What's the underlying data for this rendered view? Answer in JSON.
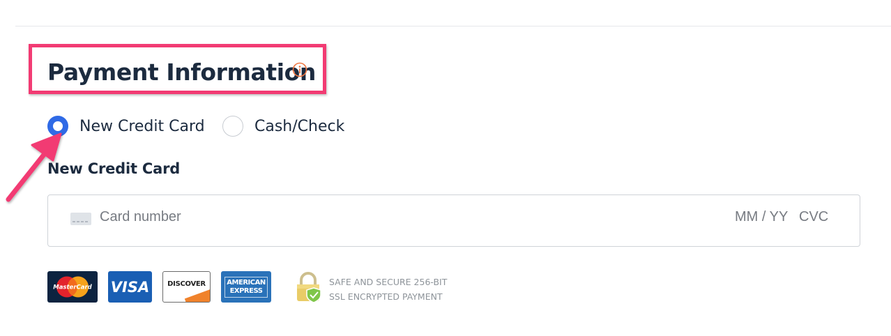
{
  "payment": {
    "title": "Payment Information",
    "options": [
      {
        "label": "New Credit Card",
        "selected": true
      },
      {
        "label": "Cash/Check",
        "selected": false
      }
    ],
    "subheading": "New Credit Card",
    "card_field": {
      "number_placeholder": "Card number",
      "expiry_placeholder": "MM / YY",
      "cvc_placeholder": "CVC"
    },
    "card_logos": [
      {
        "name": "mastercard",
        "text": "MasterCard"
      },
      {
        "name": "visa",
        "text": "VISA"
      },
      {
        "name": "discover",
        "text": "DISCOVER"
      },
      {
        "name": "amex",
        "line1": "AMERICAN",
        "line2": "EXPRESS"
      }
    ],
    "secure_lines": [
      "SAFE AND SECURE 256-BIT",
      "SSL ENCRYPTED PAYMENT"
    ]
  },
  "colors": {
    "highlight": "#f23b73",
    "radio_selected": "#2f6ae6",
    "info_icon": "#f0753f",
    "title_text": "#1c2b3f"
  },
  "icons": {
    "info": "info-circle-icon",
    "card": "credit-card-icon",
    "lock": "padlock-shield-icon",
    "annotation": "arrow-annotation"
  }
}
